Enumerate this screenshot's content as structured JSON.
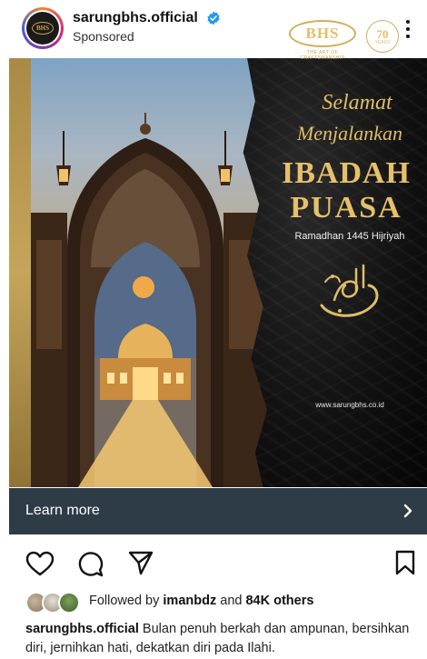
{
  "post": {
    "username": "sarungbhs.official",
    "label": "Sponsored",
    "avatar_logo": "BHS",
    "more_icon": "more-vertical-icon",
    "verified_icon": "verified-badge-icon"
  },
  "ad": {
    "brand": "BHS",
    "brand_tagline": "THE ART OF CRAFTSMANSHIP",
    "anniversary_number": "70",
    "anniversary_label": "YEARS",
    "greeting_line1": "Selamat",
    "greeting_line2": "Menjalankan",
    "title_line1": "IBADAH",
    "title_line2": "PUASA",
    "subtitle": "Ramadhan 1445 Hijriyah",
    "website": "www.sarungbhs.co.id",
    "colors": {
      "gold": "#e0bd6a",
      "dark": "#121212"
    }
  },
  "cta": {
    "label": "Learn more",
    "icon": "chevron-right-icon",
    "bar_color": "#2e3c48"
  },
  "actions": {
    "like_icon": "heart-icon",
    "comment_icon": "comment-icon",
    "share_icon": "share-icon",
    "save_icon": "bookmark-icon"
  },
  "followers": {
    "prefix": "Followed by",
    "name": "imanbdz",
    "middle": "and",
    "count": "84K others"
  },
  "caption": {
    "username": "sarungbhs.official",
    "text": "Bulan penuh berkah dan ampunan, bersihkan diri, jernihkan hati, dekatkan diri pada Ilahi."
  }
}
